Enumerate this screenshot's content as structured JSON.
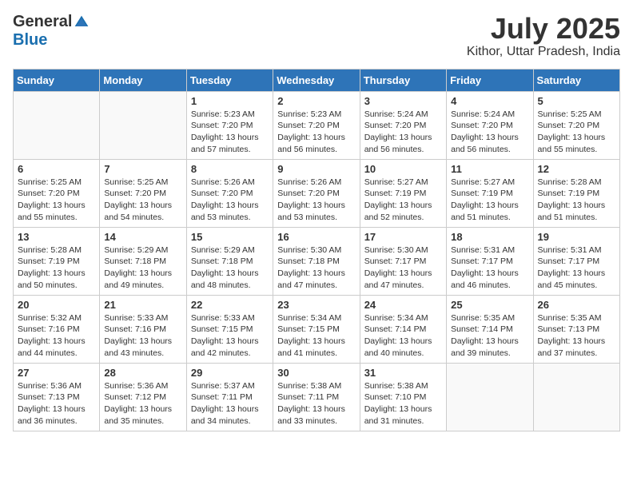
{
  "header": {
    "logo_general": "General",
    "logo_blue": "Blue",
    "month_year": "July 2025",
    "location": "Kithor, Uttar Pradesh, India"
  },
  "days_of_week": [
    "Sunday",
    "Monday",
    "Tuesday",
    "Wednesday",
    "Thursday",
    "Friday",
    "Saturday"
  ],
  "weeks": [
    [
      {
        "day": "",
        "info": ""
      },
      {
        "day": "",
        "info": ""
      },
      {
        "day": "1",
        "info": "Sunrise: 5:23 AM\nSunset: 7:20 PM\nDaylight: 13 hours and 57 minutes."
      },
      {
        "day": "2",
        "info": "Sunrise: 5:23 AM\nSunset: 7:20 PM\nDaylight: 13 hours and 56 minutes."
      },
      {
        "day": "3",
        "info": "Sunrise: 5:24 AM\nSunset: 7:20 PM\nDaylight: 13 hours and 56 minutes."
      },
      {
        "day": "4",
        "info": "Sunrise: 5:24 AM\nSunset: 7:20 PM\nDaylight: 13 hours and 56 minutes."
      },
      {
        "day": "5",
        "info": "Sunrise: 5:25 AM\nSunset: 7:20 PM\nDaylight: 13 hours and 55 minutes."
      }
    ],
    [
      {
        "day": "6",
        "info": "Sunrise: 5:25 AM\nSunset: 7:20 PM\nDaylight: 13 hours and 55 minutes."
      },
      {
        "day": "7",
        "info": "Sunrise: 5:25 AM\nSunset: 7:20 PM\nDaylight: 13 hours and 54 minutes."
      },
      {
        "day": "8",
        "info": "Sunrise: 5:26 AM\nSunset: 7:20 PM\nDaylight: 13 hours and 53 minutes."
      },
      {
        "day": "9",
        "info": "Sunrise: 5:26 AM\nSunset: 7:20 PM\nDaylight: 13 hours and 53 minutes."
      },
      {
        "day": "10",
        "info": "Sunrise: 5:27 AM\nSunset: 7:19 PM\nDaylight: 13 hours and 52 minutes."
      },
      {
        "day": "11",
        "info": "Sunrise: 5:27 AM\nSunset: 7:19 PM\nDaylight: 13 hours and 51 minutes."
      },
      {
        "day": "12",
        "info": "Sunrise: 5:28 AM\nSunset: 7:19 PM\nDaylight: 13 hours and 51 minutes."
      }
    ],
    [
      {
        "day": "13",
        "info": "Sunrise: 5:28 AM\nSunset: 7:19 PM\nDaylight: 13 hours and 50 minutes."
      },
      {
        "day": "14",
        "info": "Sunrise: 5:29 AM\nSunset: 7:18 PM\nDaylight: 13 hours and 49 minutes."
      },
      {
        "day": "15",
        "info": "Sunrise: 5:29 AM\nSunset: 7:18 PM\nDaylight: 13 hours and 48 minutes."
      },
      {
        "day": "16",
        "info": "Sunrise: 5:30 AM\nSunset: 7:18 PM\nDaylight: 13 hours and 47 minutes."
      },
      {
        "day": "17",
        "info": "Sunrise: 5:30 AM\nSunset: 7:17 PM\nDaylight: 13 hours and 47 minutes."
      },
      {
        "day": "18",
        "info": "Sunrise: 5:31 AM\nSunset: 7:17 PM\nDaylight: 13 hours and 46 minutes."
      },
      {
        "day": "19",
        "info": "Sunrise: 5:31 AM\nSunset: 7:17 PM\nDaylight: 13 hours and 45 minutes."
      }
    ],
    [
      {
        "day": "20",
        "info": "Sunrise: 5:32 AM\nSunset: 7:16 PM\nDaylight: 13 hours and 44 minutes."
      },
      {
        "day": "21",
        "info": "Sunrise: 5:33 AM\nSunset: 7:16 PM\nDaylight: 13 hours and 43 minutes."
      },
      {
        "day": "22",
        "info": "Sunrise: 5:33 AM\nSunset: 7:15 PM\nDaylight: 13 hours and 42 minutes."
      },
      {
        "day": "23",
        "info": "Sunrise: 5:34 AM\nSunset: 7:15 PM\nDaylight: 13 hours and 41 minutes."
      },
      {
        "day": "24",
        "info": "Sunrise: 5:34 AM\nSunset: 7:14 PM\nDaylight: 13 hours and 40 minutes."
      },
      {
        "day": "25",
        "info": "Sunrise: 5:35 AM\nSunset: 7:14 PM\nDaylight: 13 hours and 39 minutes."
      },
      {
        "day": "26",
        "info": "Sunrise: 5:35 AM\nSunset: 7:13 PM\nDaylight: 13 hours and 37 minutes."
      }
    ],
    [
      {
        "day": "27",
        "info": "Sunrise: 5:36 AM\nSunset: 7:13 PM\nDaylight: 13 hours and 36 minutes."
      },
      {
        "day": "28",
        "info": "Sunrise: 5:36 AM\nSunset: 7:12 PM\nDaylight: 13 hours and 35 minutes."
      },
      {
        "day": "29",
        "info": "Sunrise: 5:37 AM\nSunset: 7:11 PM\nDaylight: 13 hours and 34 minutes."
      },
      {
        "day": "30",
        "info": "Sunrise: 5:38 AM\nSunset: 7:11 PM\nDaylight: 13 hours and 33 minutes."
      },
      {
        "day": "31",
        "info": "Sunrise: 5:38 AM\nSunset: 7:10 PM\nDaylight: 13 hours and 31 minutes."
      },
      {
        "day": "",
        "info": ""
      },
      {
        "day": "",
        "info": ""
      }
    ]
  ]
}
